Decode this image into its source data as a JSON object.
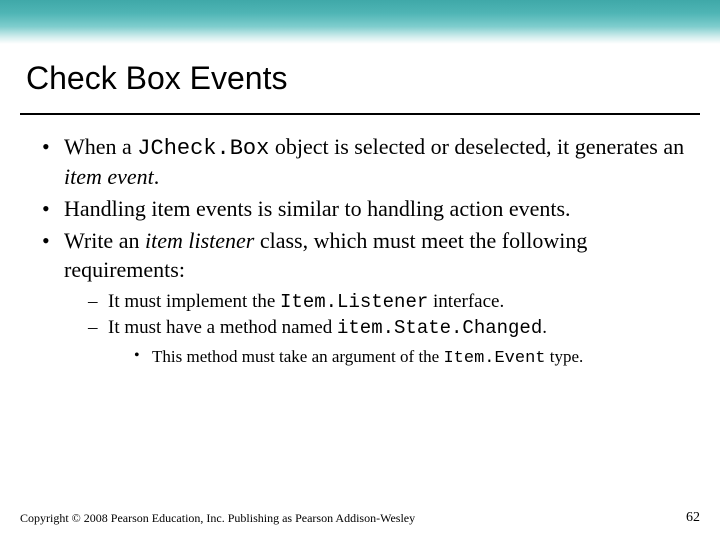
{
  "title": "Check Box Events",
  "bullets": {
    "b1_a": "When a ",
    "b1_code": "JCheck.Box",
    "b1_b": " object is selected or deselected, it generates an ",
    "b1_ital": "item event",
    "b1_c": ".",
    "b2": "Handling item events is similar to handling action events.",
    "b3_a": "Write an ",
    "b3_ital": "item listener",
    "b3_b": " class, which must meet the following requirements:",
    "sub1_a": "It must implement the ",
    "sub1_code": "Item.Listener",
    "sub1_b": " interface.",
    "sub2_a": "It must have a method named ",
    "sub2_code": "item.State.Changed",
    "sub2_b": ".",
    "subsub_a": "This method must take an argument of the ",
    "subsub_code": "Item.Event",
    "subsub_b": " type."
  },
  "footer": {
    "copyright": "Copyright © 2008 Pearson Education, Inc. Publishing as Pearson Addison-Wesley",
    "page": "62"
  }
}
